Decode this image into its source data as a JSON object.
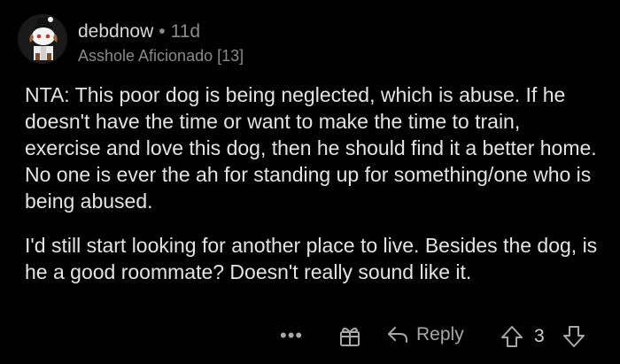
{
  "comment": {
    "username": "debdnow",
    "separator": "•",
    "age": "11d",
    "flair": "Asshole Aficionado [13]",
    "paragraphs": [
      "NTA: This poor dog is being neglected, which is abuse. If he doesn't have the time or want to make the time to train, exercise and love this dog, then he should find it a better home. No one is ever the ah for standing up for something/one who is being abused.",
      "I'd still start looking for another place to live. Besides the dog, is he a good roommate? Doesn't really sound like it."
    ]
  },
  "actions": {
    "more_label": "•••",
    "reply_label": "Reply",
    "score": "3"
  },
  "icons": {
    "avatar": "snoo-avatar-with-top-hat",
    "more": "more-options-icon",
    "award": "award-gift-icon",
    "reply": "reply-arrow-icon",
    "upvote": "upvote-arrow-icon",
    "downvote": "downvote-arrow-icon"
  },
  "colors": {
    "background": "#000000",
    "text": "#e4e4e4",
    "muted": "#8a8a8a"
  }
}
